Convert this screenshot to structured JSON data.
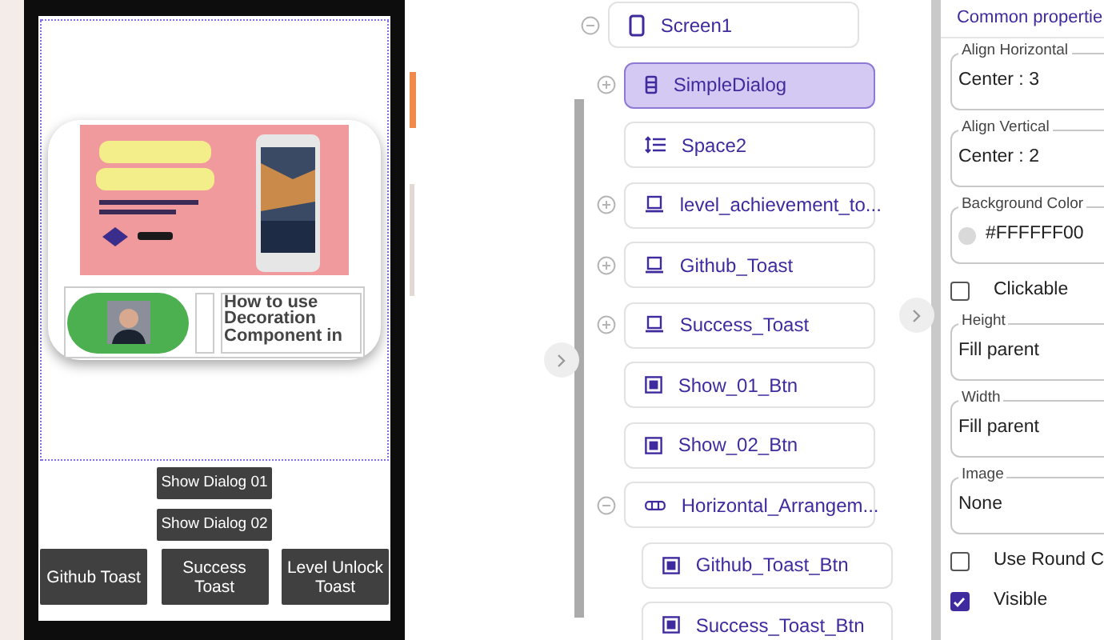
{
  "phone": {
    "card": {
      "video_title": "How to use Decoration Component in"
    },
    "buttons": [
      {
        "label": "Show Dialog 01"
      },
      {
        "label": "Show Dialog 02"
      }
    ],
    "toast_buttons": [
      {
        "label": "Github Toast"
      },
      {
        "label": "Success Toast"
      },
      {
        "label": "Level Unlock Toast"
      }
    ]
  },
  "tree": {
    "root": {
      "label": "Screen1",
      "kind": "screen",
      "expanded": true,
      "selected": false,
      "children": [
        {
          "label": "SimpleDialog",
          "kind": "dialog",
          "expanded": false,
          "selected": true
        },
        {
          "label": "Space2",
          "kind": "space",
          "selected": false
        },
        {
          "label": "level_achievement_to...",
          "kind": "toast",
          "expanded": false,
          "selected": false
        },
        {
          "label": "Github_Toast",
          "kind": "toast",
          "expanded": false,
          "selected": false
        },
        {
          "label": "Success_Toast",
          "kind": "toast",
          "expanded": false,
          "selected": false
        },
        {
          "label": "Show_01_Btn",
          "kind": "button",
          "selected": false
        },
        {
          "label": "Show_02_Btn",
          "kind": "button",
          "selected": false
        },
        {
          "label": "Horizontal_Arrangem...",
          "kind": "arrangement",
          "expanded": true,
          "selected": false,
          "children": [
            {
              "label": "Github_Toast_Btn",
              "kind": "button",
              "selected": false
            },
            {
              "label": "Success_Toast_Btn",
              "kind": "button",
              "selected": false
            }
          ]
        }
      ]
    }
  },
  "properties": {
    "title": "Common propertie",
    "items": [
      {
        "kind": "field",
        "label": "Align Horizontal",
        "value": "Center : 3"
      },
      {
        "kind": "field",
        "label": "Align Vertical",
        "value": "Center : 2"
      },
      {
        "kind": "color",
        "label": "Background Color",
        "value": "#FFFFFF00",
        "color": "#d9d9d9"
      },
      {
        "kind": "checkbox",
        "label": "Clickable",
        "checked": false
      },
      {
        "kind": "field",
        "label": "Height",
        "value": "Fill parent"
      },
      {
        "kind": "field",
        "label": "Width",
        "value": "Fill parent"
      },
      {
        "kind": "field",
        "label": "Image",
        "value": "None"
      },
      {
        "kind": "checkbox",
        "label": "Use Round C",
        "checked": false
      },
      {
        "kind": "checkbox",
        "label": "Visible",
        "checked": true
      }
    ]
  }
}
